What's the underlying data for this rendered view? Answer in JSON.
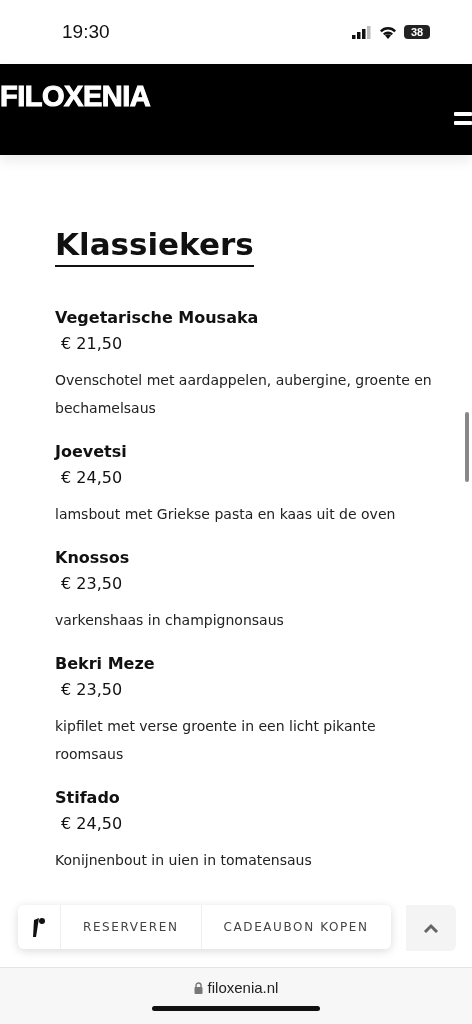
{
  "status_bar": {
    "time": "19:30",
    "battery": "38"
  },
  "header": {
    "logo": "FILOXENIA"
  },
  "section": {
    "title": "Klassiekers",
    "items": [
      {
        "name": "Vegetarische Mousaka",
        "price": "€ 21,50",
        "description": "Ovenschotel met aardappelen, aubergine, groente en bechamelsaus"
      },
      {
        "name": "Joevetsi",
        "price": "€ 24,50",
        "description": "lamsbout met Griekse pasta en kaas uit de oven"
      },
      {
        "name": "Knossos",
        "price": "€ 23,50",
        "description": "varkenshaas in champignonsaus"
      },
      {
        "name": "Bekri Meze",
        "price": "€ 23,50",
        "description": "kipfilet met verse groente in een licht pikante roomsaus"
      },
      {
        "name": "Stifado",
        "price": "€ 24,50",
        "description": "Konijnenbout in uien in tomatensaus"
      }
    ]
  },
  "action_bar": {
    "buttons": [
      "RESERVEREN",
      "CADEAUBON KOPEN"
    ]
  },
  "browser_bar": {
    "url": "filoxenia.nl"
  }
}
